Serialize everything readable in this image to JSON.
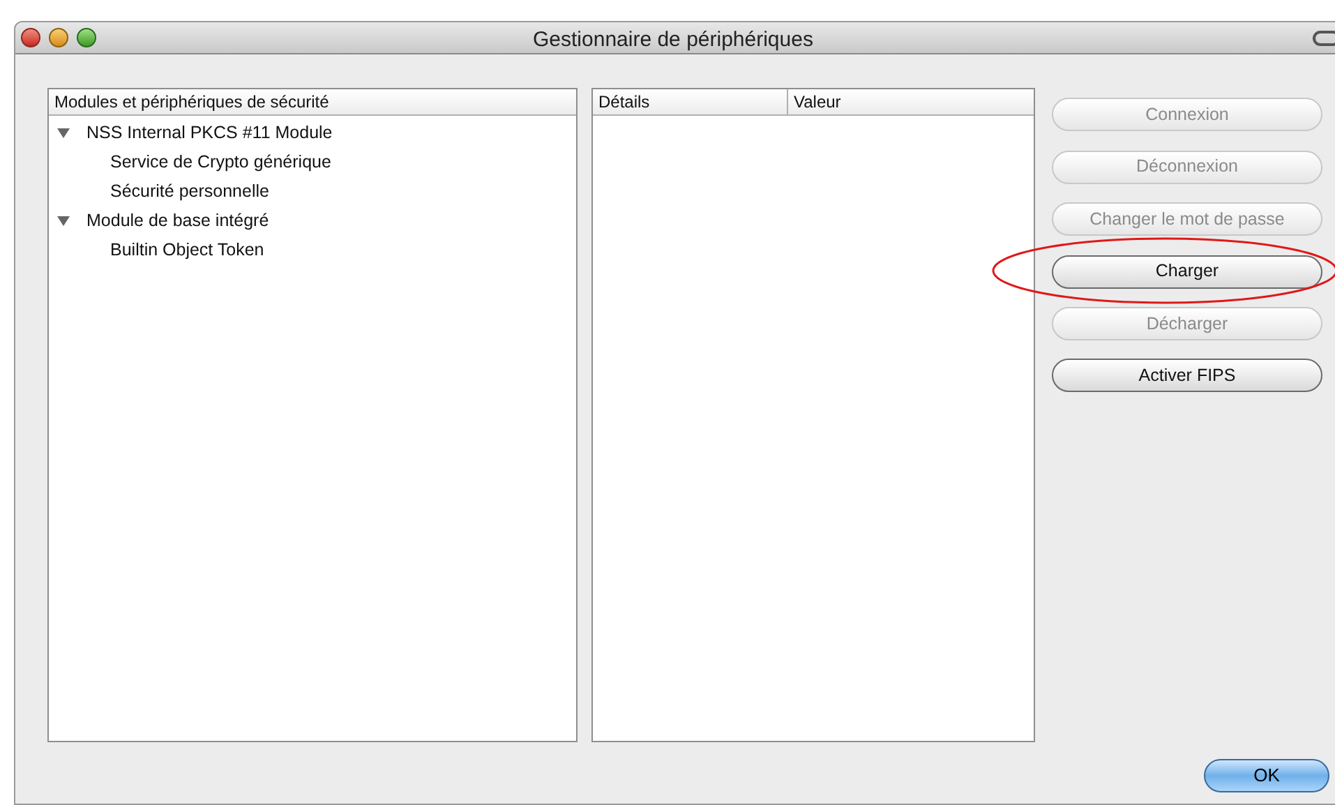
{
  "window": {
    "title": "Gestionnaire de périphériques"
  },
  "tree": {
    "column": "Modules et périphériques de sécurité",
    "items": [
      {
        "label": "NSS Internal PKCS #11 Module",
        "expanded": true,
        "children": [
          {
            "label": "Service de Crypto générique"
          },
          {
            "label": "Sécurité personnelle"
          }
        ]
      },
      {
        "label": "Module de base intégré",
        "expanded": true,
        "children": [
          {
            "label": "Builtin Object Token"
          }
        ]
      }
    ]
  },
  "details": {
    "columns": [
      "Détails",
      "Valeur"
    ]
  },
  "buttons": [
    {
      "label": "Connexion",
      "disabled": true,
      "circled": false
    },
    {
      "label": "Déconnexion",
      "disabled": true,
      "circled": false
    },
    {
      "label": "Changer le mot de passe",
      "disabled": true,
      "circled": false
    },
    {
      "label": "Charger",
      "disabled": false,
      "circled": true
    },
    {
      "label": "Décharger",
      "disabled": true,
      "circled": false
    },
    {
      "label": "Activer FIPS",
      "disabled": false,
      "circled": false
    }
  ],
  "ok_button": {
    "label": "OK"
  }
}
